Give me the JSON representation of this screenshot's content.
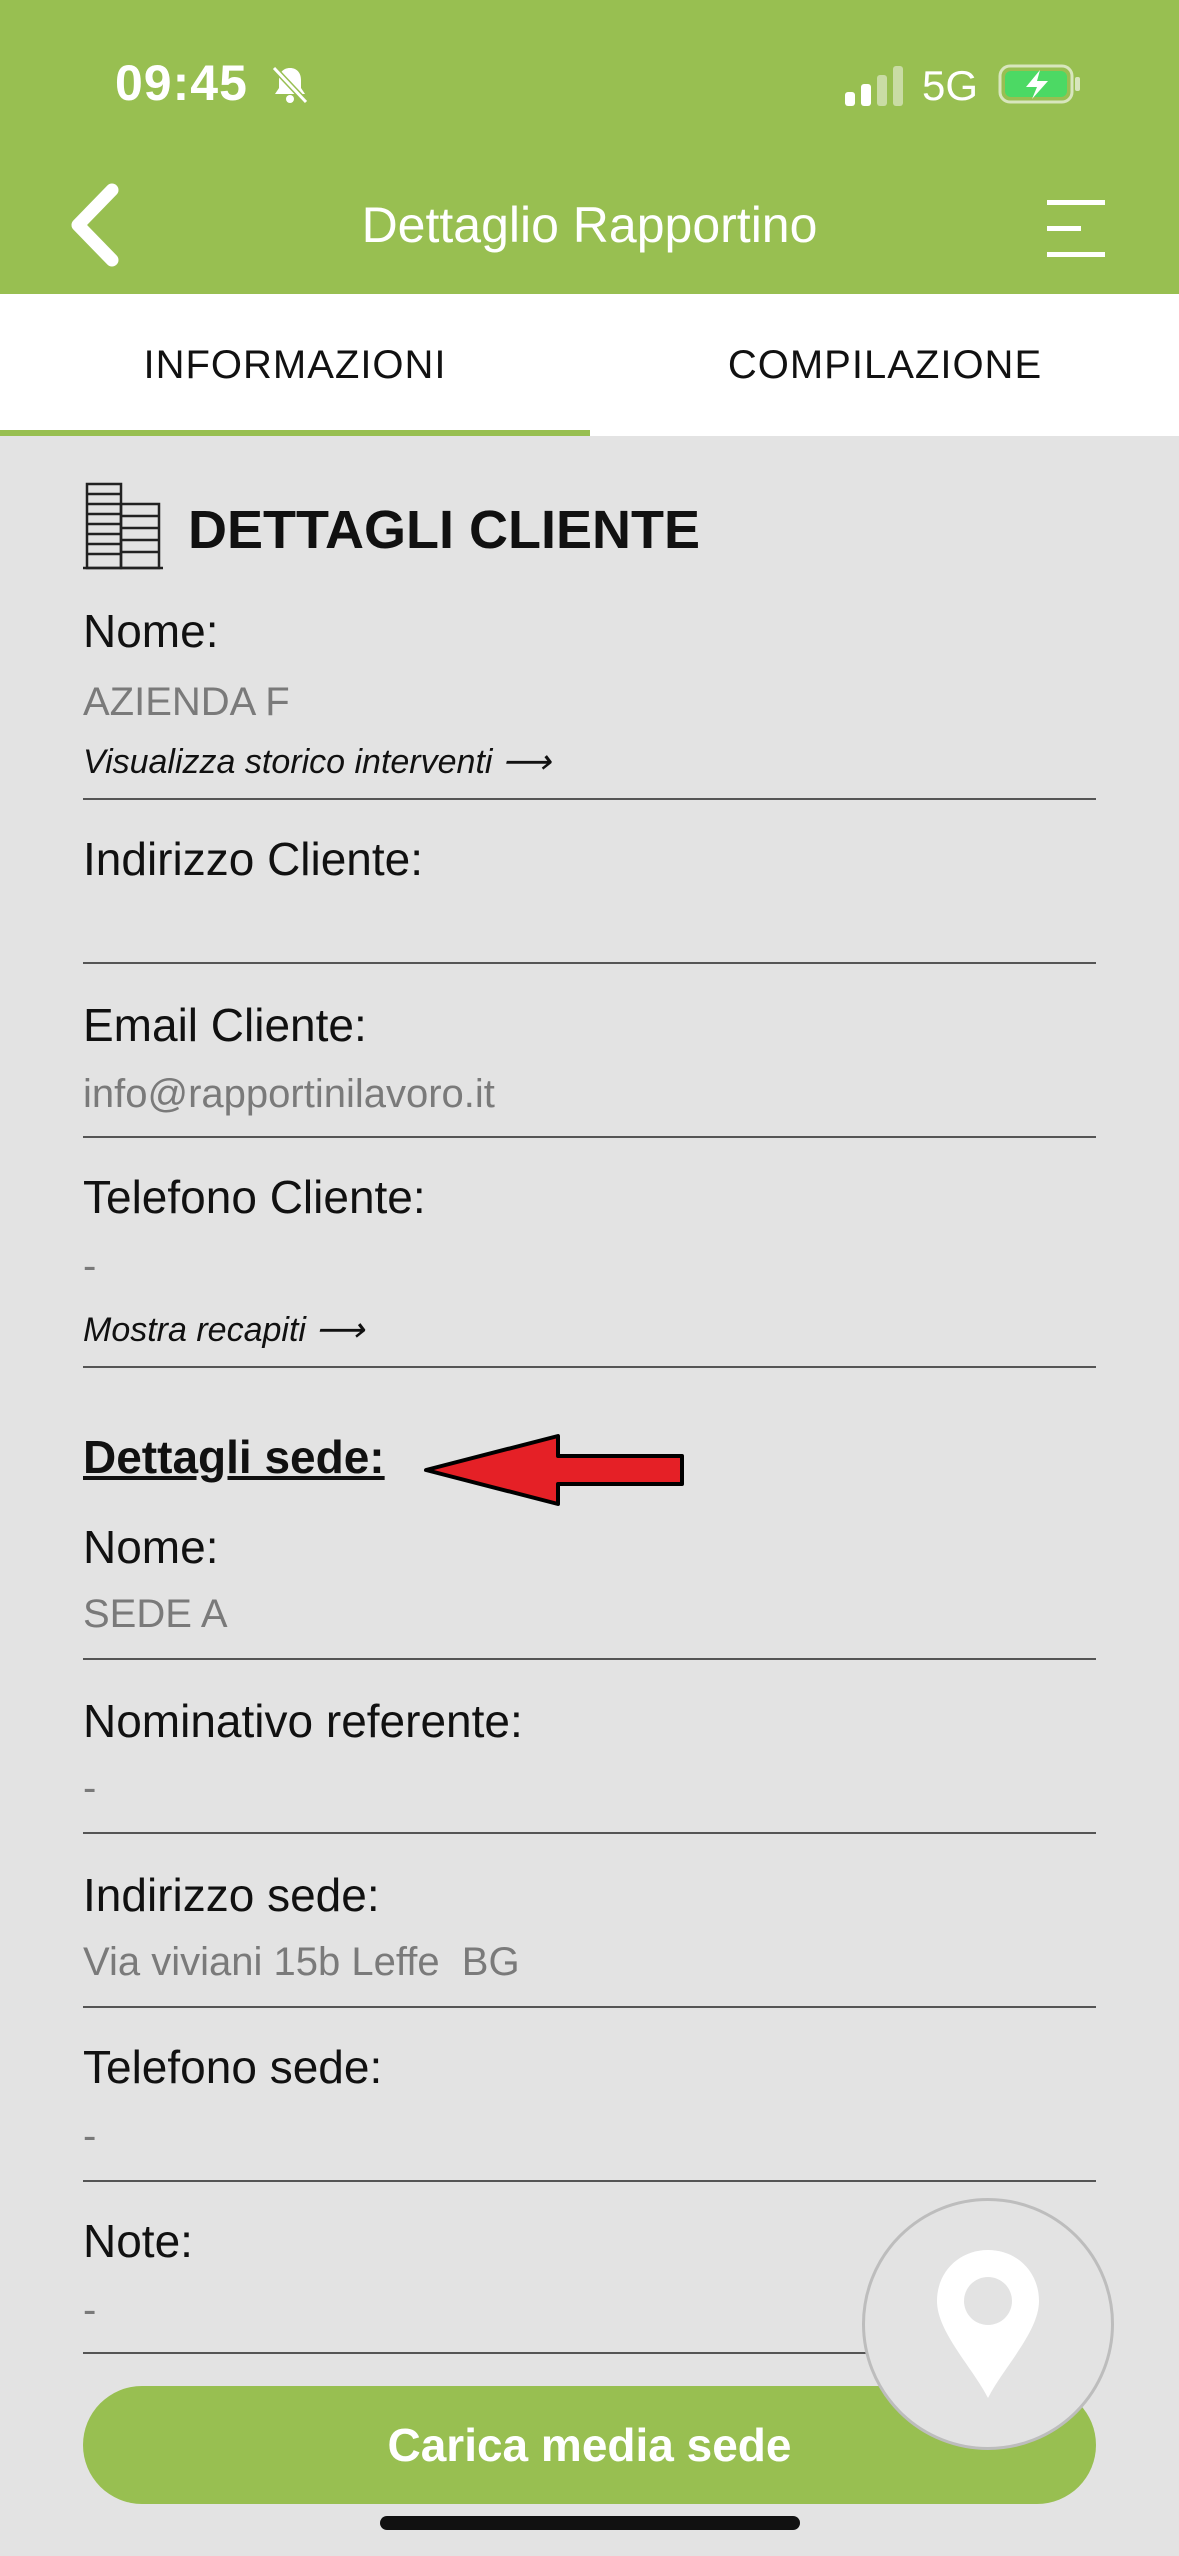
{
  "status": {
    "time": "09:45",
    "network": "5G"
  },
  "header": {
    "title": "Dettaglio Rapportino"
  },
  "tabs": [
    {
      "label": "INFORMAZIONI",
      "active": true
    },
    {
      "label": "COMPILAZIONE",
      "active": false
    }
  ],
  "cliente": {
    "section_title": "DETTAGLI CLIENTE",
    "nome_label": "Nome:",
    "nome_value": "AZIENDA F",
    "storico_link": "Visualizza storico interventi ⟶",
    "indirizzo_label": "Indirizzo Cliente:",
    "indirizzo_value": "",
    "email_label": "Email Cliente:",
    "email_value": "info@rapportinilavoro.it",
    "telefono_label": "Telefono Cliente:",
    "telefono_value": "-",
    "recapiti_link": "Mostra recapiti ⟶"
  },
  "sede": {
    "section_title": "Dettagli sede:",
    "nome_label": "Nome:",
    "nome_value": "SEDE A",
    "referente_label": "Nominativo referente:",
    "referente_value": "-",
    "indirizzo_label": "Indirizzo sede:",
    "indirizzo_value": "Via viviani 15b Leffe  BG",
    "telefono_label": "Telefono sede:",
    "telefono_value": "-",
    "note_label": "Note:",
    "note_value": "-"
  },
  "actions": {
    "upload_label": "Carica media sede"
  },
  "colors": {
    "accent": "#98bf51",
    "background": "#e3e3e3",
    "arrow": "#e52026"
  }
}
